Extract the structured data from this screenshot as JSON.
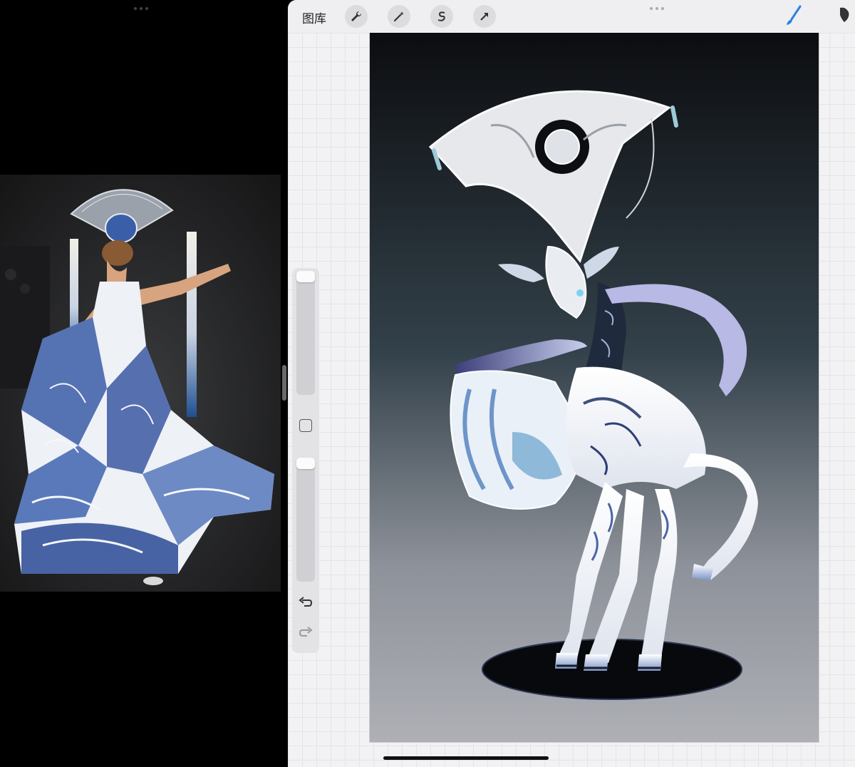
{
  "toolbar": {
    "gallery_label": "图库",
    "tools": [
      "wrench-icon",
      "magic-wand-icon",
      "selection-icon",
      "transform-arrow-icon"
    ],
    "right_tools": [
      "brush-icon",
      "smudge-icon"
    ],
    "accent_color": "#2f7fe0"
  },
  "sidebar": {
    "brush_size_level": 0.0,
    "opacity_level": 0.0,
    "buttons": [
      "modify-square-icon",
      "undo-icon",
      "redo-icon"
    ]
  },
  "left_pane": {
    "content": "reference-photo"
  },
  "colors": {
    "porcelain_blue": "#2f4f9e",
    "canvas_dark": "#0c0d10",
    "canvas_light": "#a9abb1"
  }
}
